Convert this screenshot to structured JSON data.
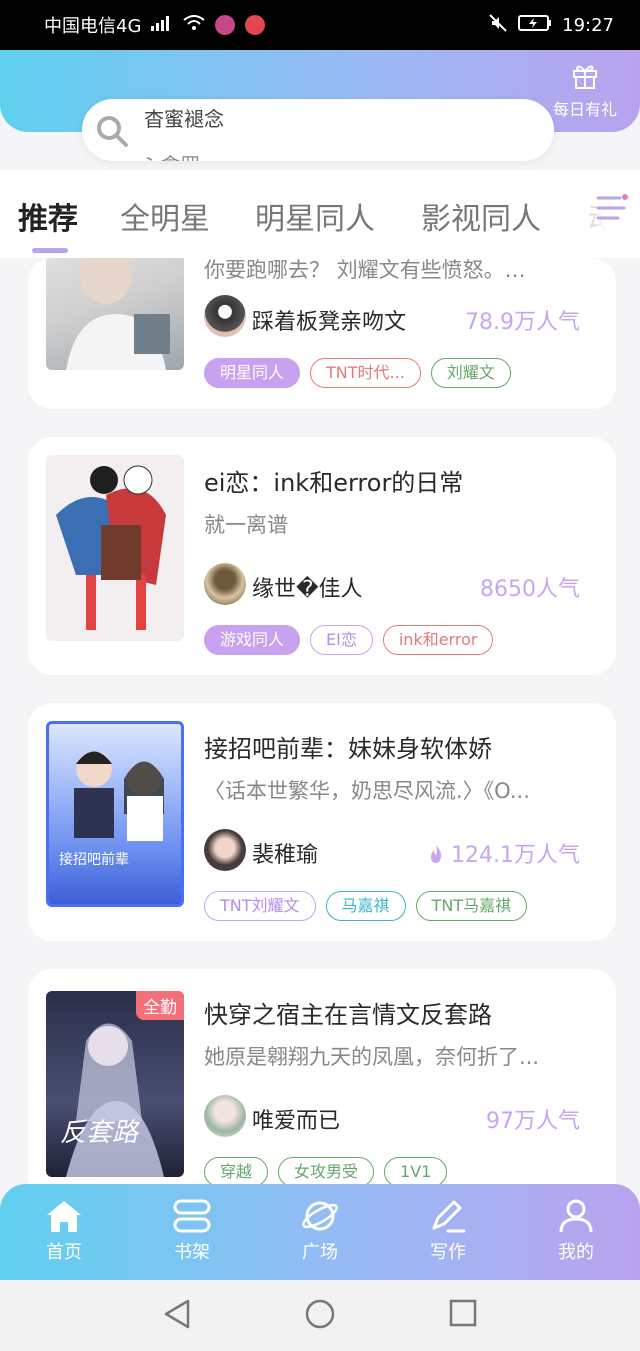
{
  "status": {
    "carrier": "中国电信4G",
    "network": "⁴ᴳ",
    "time": "19:27"
  },
  "header": {
    "gift_label": "每日有礼"
  },
  "search": {
    "text": "杳蜜褪念",
    "ghost_text": "ﾐ 盒罒"
  },
  "tabs": [
    "推荐",
    "全明星",
    "明星同人",
    "影视同人",
    "动漫"
  ],
  "books": [
    {
      "title": "",
      "desc": "你要跑哪去？ 刘耀文有些愤怒。…",
      "author": "踩着板凳亲吻文",
      "popularity": "78.9万人气",
      "hot": false,
      "tags": [
        "明星同人",
        "TNT时代...",
        "刘耀文"
      ]
    },
    {
      "title": "ei恋：ink和error的日常",
      "desc": "就一离谱",
      "author": "缘世�佳人",
      "popularity": "8650人气",
      "hot": false,
      "tags": [
        "游戏同人",
        "EI恋",
        "ink和error"
      ]
    },
    {
      "title": "接招吧前辈：妹妹身软体娇",
      "desc": "〈话本世繁华，奶思尽风流.〉《O...",
      "author": "裴稚瑜",
      "popularity": "124.1万人气",
      "hot": true,
      "tags": [
        "TNT刘耀文",
        "马嘉祺",
        "TNT马嘉祺"
      ]
    },
    {
      "title": "快穿之宿主在言情文反套路",
      "desc": "她原是翱翔九天的凤凰，奈何折了...",
      "author": "唯爱而已",
      "popularity": "97万人气",
      "hot": false,
      "badge": "全勤",
      "tags": [
        "穿越",
        "女攻男受",
        "1V1"
      ]
    }
  ],
  "nav": [
    "首页",
    "书架",
    "广场",
    "写作",
    "我的"
  ],
  "colors": {
    "gradient_start": "#5fd0ef",
    "gradient_end": "#b9a2ee",
    "accent": "#c9a2ef"
  }
}
